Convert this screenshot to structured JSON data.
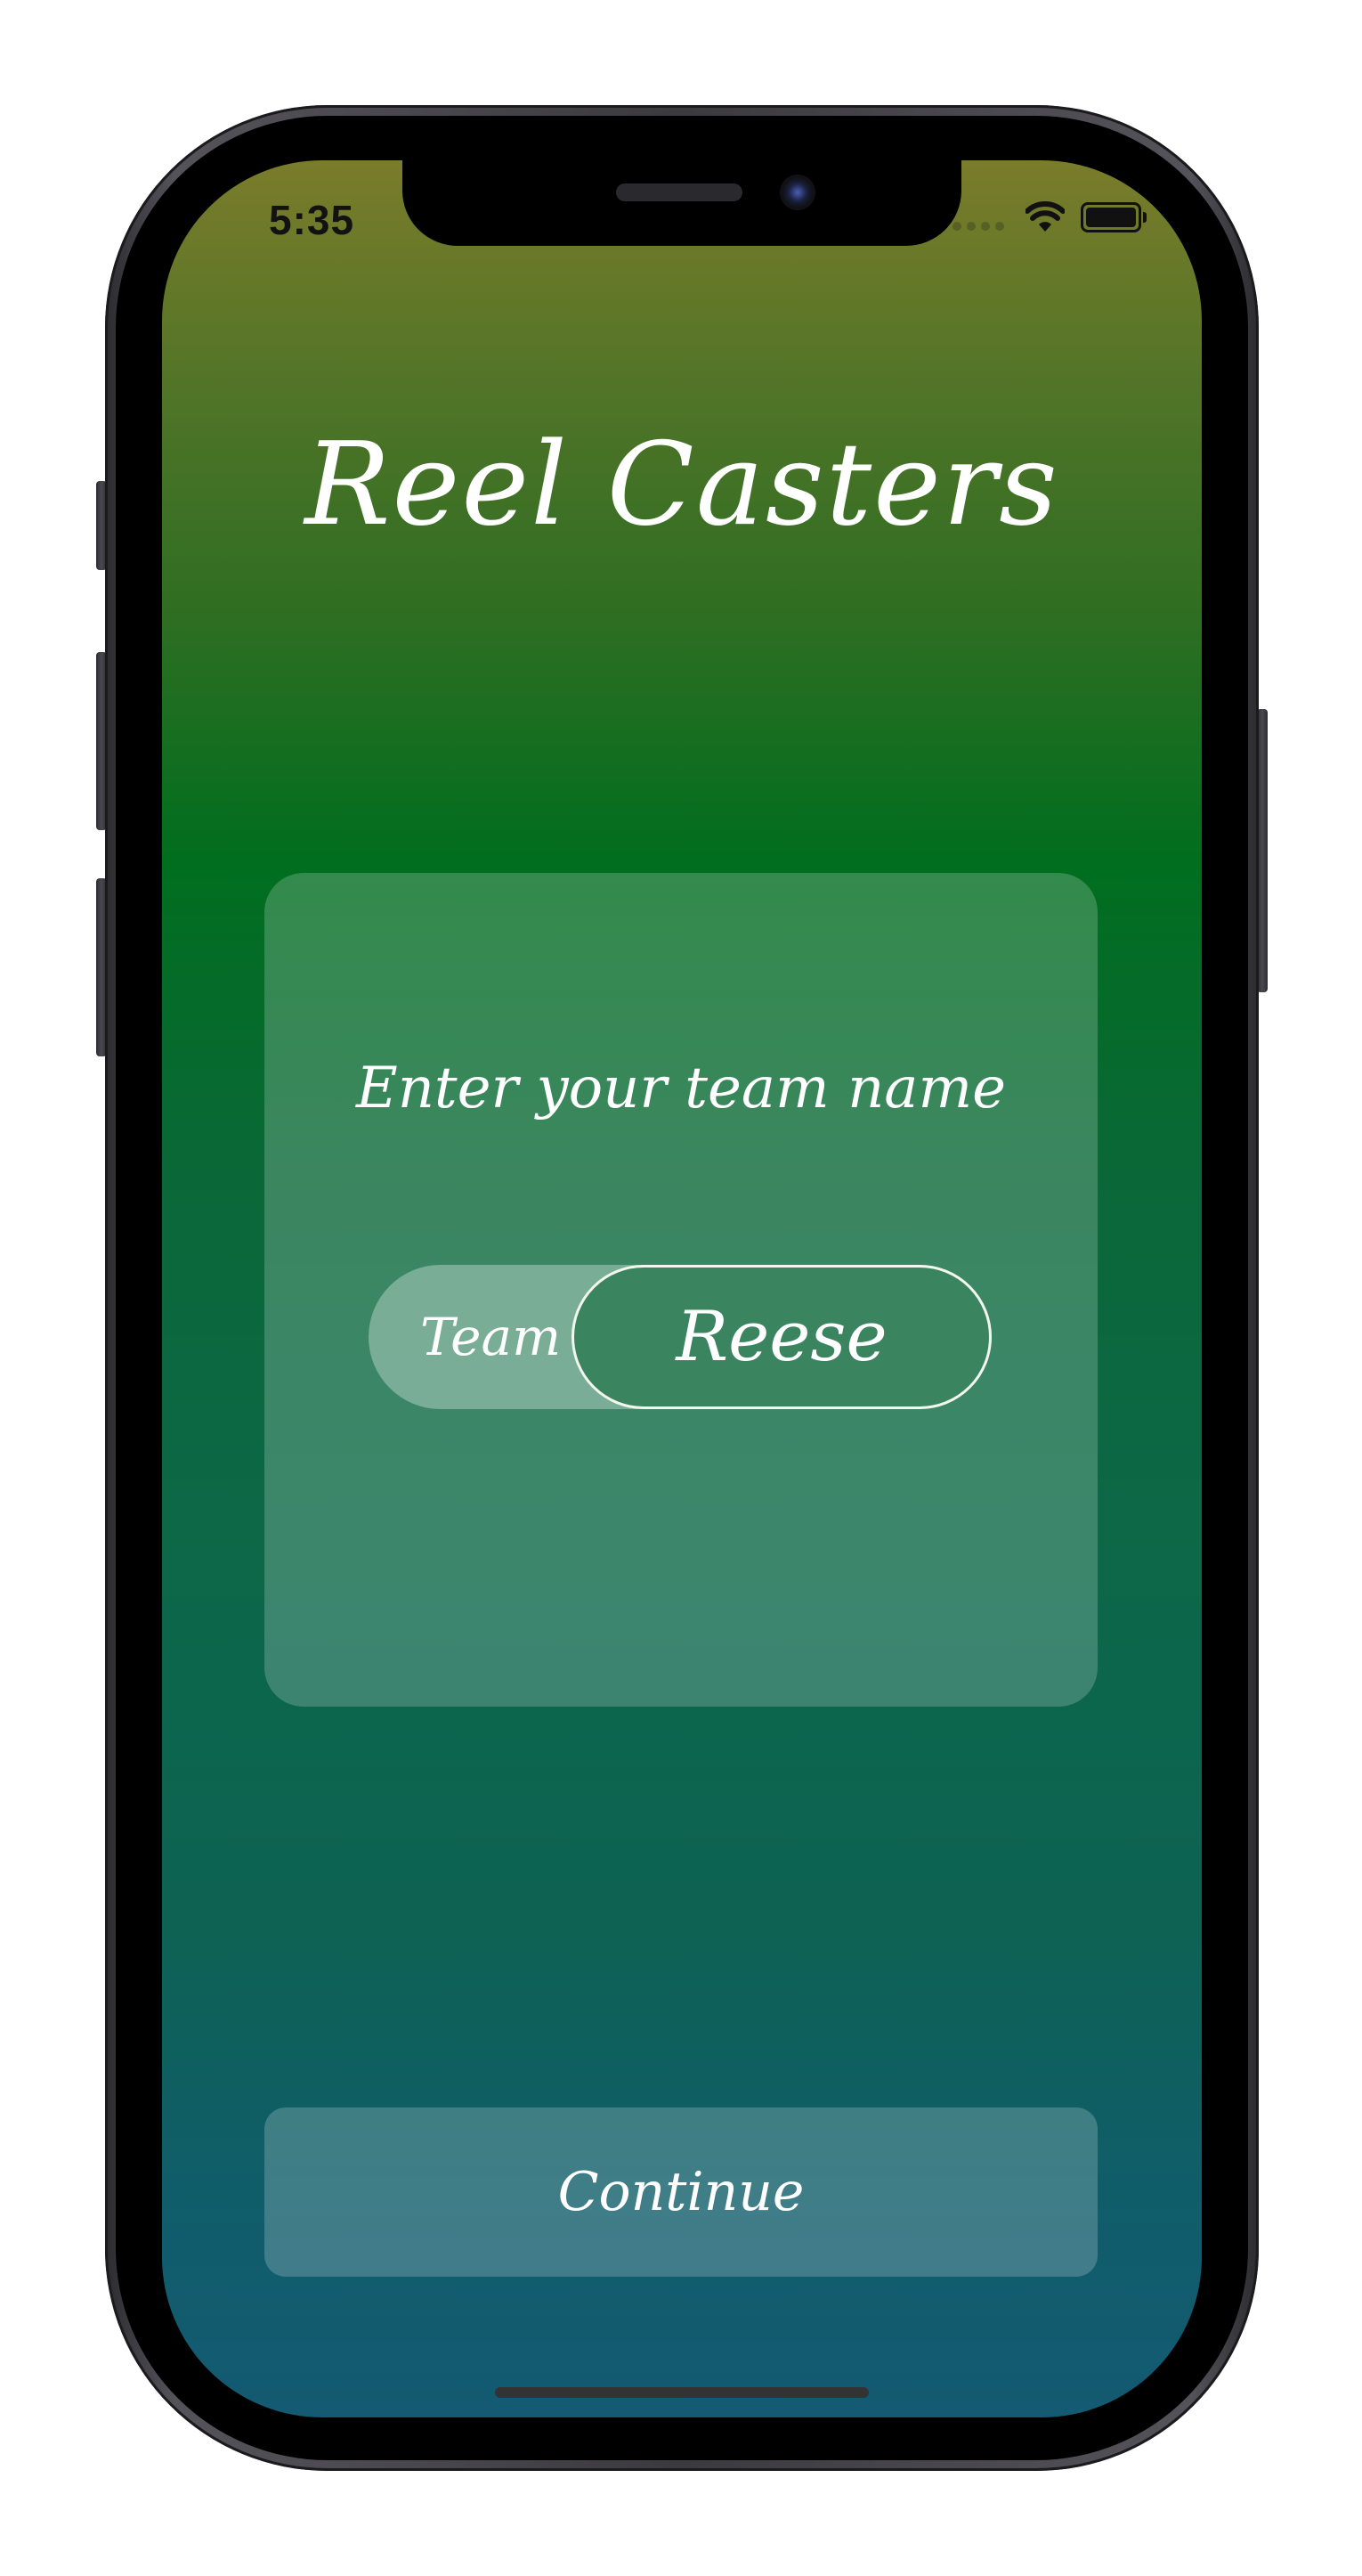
{
  "status_bar": {
    "time": "5:35",
    "icons": [
      "cellular-signal-icon",
      "wifi-icon",
      "battery-icon"
    ]
  },
  "app": {
    "title": "Reel Casters",
    "card": {
      "prompt": "Enter your team name",
      "field": {
        "prefix": "Team",
        "value": "Reese"
      }
    },
    "continue_label": "Continue"
  },
  "colors": {
    "gradient_top": "#7a7c2a",
    "gradient_mid": "#006e1e",
    "gradient_bottom": "#135a72",
    "text": "#ffffff"
  }
}
